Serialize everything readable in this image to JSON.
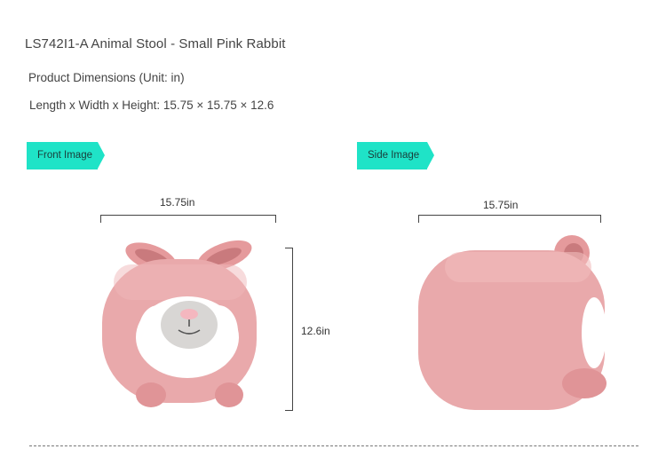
{
  "product": {
    "title": "LS742I1-A Animal Stool - Small Pink Rabbit"
  },
  "dimensions": {
    "heading": "Product Dimensions (Unit: in)",
    "line": "Length x Width x Height: 15.75 × 15.75 × 12.6"
  },
  "front_view": {
    "tag_label": "Front Image",
    "width_label": "15.75in",
    "height_label": "12.6in"
  },
  "side_view": {
    "tag_label": "Side Image",
    "width_label": "15.75in"
  },
  "colors": {
    "tag_accent": "#1fe3c7",
    "stool_pink": "#e9a9ab",
    "fur_white": "#ffffff"
  }
}
